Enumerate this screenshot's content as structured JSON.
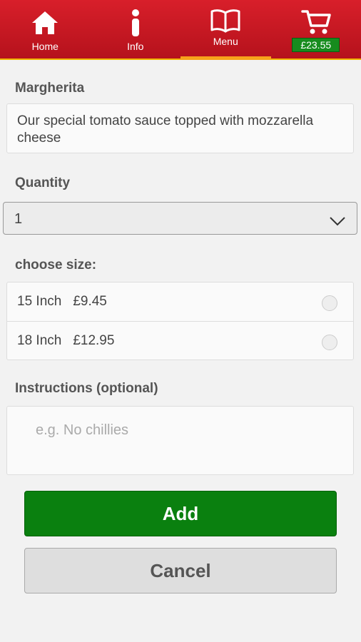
{
  "nav": {
    "items": [
      {
        "label": "Home",
        "icon": "home-icon"
      },
      {
        "label": "Info",
        "icon": "info-icon"
      },
      {
        "label": "Menu",
        "icon": "book-icon"
      }
    ],
    "cart_total": "£23.55",
    "accent": "#f7a21b",
    "bar_color": "#c8161f"
  },
  "product": {
    "name": "Margherita",
    "description": "Our special tomato sauce topped with mozzarella cheese"
  },
  "quantity": {
    "label": "Quantity",
    "value": "1"
  },
  "size": {
    "label": "choose size:",
    "options": [
      {
        "size": "15 Inch",
        "price": "£9.45"
      },
      {
        "size": "18 Inch",
        "price": "£12.95"
      }
    ]
  },
  "instructions": {
    "label": "Instructions (optional)",
    "placeholder": "e.g. No chillies"
  },
  "actions": {
    "add": "Add",
    "cancel": "Cancel",
    "add_color": "#0a800f"
  }
}
